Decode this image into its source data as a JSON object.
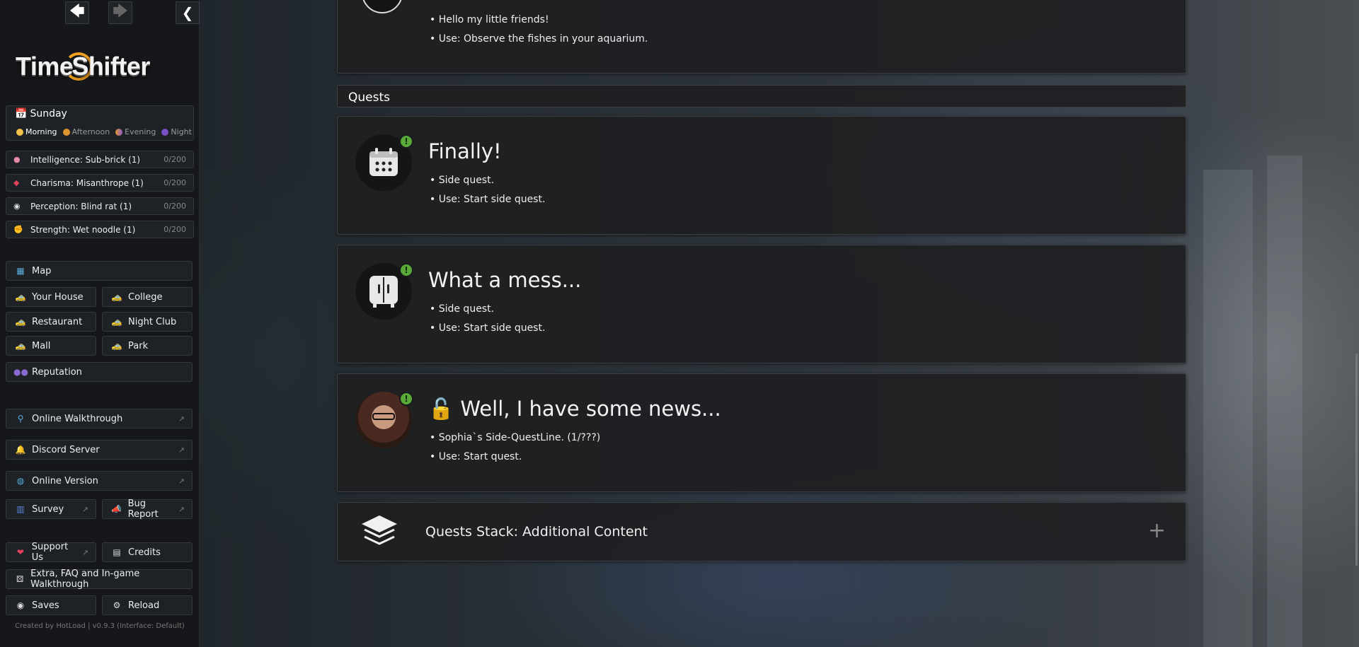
{
  "nav": {
    "back": "🡄",
    "forward": "🡆",
    "collapse": "❮"
  },
  "logo": {
    "text_a": "Time",
    "text_b": "Shifter"
  },
  "day": {
    "name": "Sunday",
    "times": [
      "Morning",
      "Afternoon",
      "Evening",
      "Night"
    ],
    "active": "Morning"
  },
  "stats": [
    {
      "icon": "brain-icon",
      "label": "Intelligence: Sub-brick (1)",
      "value": "0/200"
    },
    {
      "icon": "lips-icon",
      "label": "Charisma: Misanthrope (1)",
      "value": "0/200"
    },
    {
      "icon": "eyes-icon",
      "label": "Perception: Blind rat (1)",
      "value": "0/200"
    },
    {
      "icon": "muscle-icon",
      "label": "Strength: Wet noodle (1)",
      "value": "0/200"
    }
  ],
  "map": {
    "label": "Map"
  },
  "locations": [
    {
      "label": "Your House"
    },
    {
      "label": "College"
    },
    {
      "label": "Restaurant"
    },
    {
      "label": "Night Club"
    },
    {
      "label": "Mall"
    },
    {
      "label": "Park"
    }
  ],
  "reputation": {
    "label": "Reputation"
  },
  "links": {
    "walkthrough": "Online Walkthrough",
    "discord": "Discord Server",
    "online_version": "Online Version",
    "survey": "Survey",
    "bug_report": "Bug Report",
    "support": "Support Us",
    "credits": "Credits",
    "extra": "Extra, FAQ and In-game Walkthrough",
    "saves": "Saves",
    "reload": "Reload"
  },
  "footer": "Created by HotLoad | v0.9.3 (Interface: Default)",
  "top_card": {
    "lines": [
      "• Hello my little friends!",
      "• Use: Observe the fishes in your aquarium."
    ]
  },
  "quests_header": "Quests",
  "quests": [
    {
      "title": "Finally!",
      "lines": [
        "• Side quest.",
        "• Use: Start side quest."
      ],
      "icon": "calendar-icon"
    },
    {
      "title": "What a mess...",
      "lines": [
        "• Side quest.",
        "• Use: Start side quest."
      ],
      "icon": "wardrobe-icon"
    },
    {
      "title": "Well, I have some news...",
      "lines": [
        "• Sophia`s Side-QuestLine. (1/???)",
        "• Use: Start quest."
      ],
      "icon": "sophia-avatar",
      "prefix": "🔓"
    }
  ],
  "stack": {
    "label": "Quests Stack: Additional Content",
    "toggle": "+"
  },
  "colors": {
    "accent": "#f0a020",
    "badge": "#5aaa3a"
  }
}
